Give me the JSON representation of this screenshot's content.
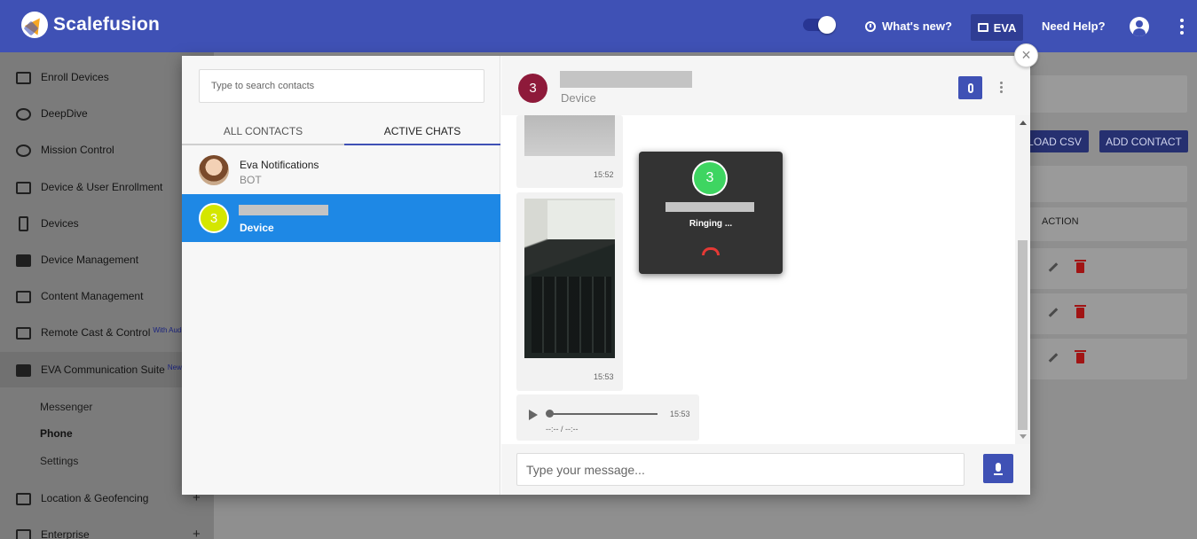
{
  "header": {
    "brand": "Scalefusion",
    "whats_new": "What's new?",
    "eva_label": "EVA",
    "need_help": "Need Help?"
  },
  "sidebar": {
    "items": [
      {
        "label": "Enroll Devices",
        "icon": "enroll-icon"
      },
      {
        "label": "DeepDive",
        "icon": "deepdive-icon"
      },
      {
        "label": "Mission Control",
        "icon": "mission-control-icon"
      },
      {
        "label": "Device & User Enrollment",
        "icon": "device-user-icon"
      },
      {
        "label": "Devices",
        "icon": "phone-icon"
      },
      {
        "label": "Device Management",
        "icon": "briefcase-icon"
      },
      {
        "label": "Content Management",
        "icon": "folder-icon"
      },
      {
        "label": "Remote Cast & Control",
        "icon": "cast-icon",
        "badge": "With Audio"
      },
      {
        "label": "EVA Communication Suite",
        "icon": "chat-icon",
        "badge": "New"
      }
    ],
    "subitems": [
      "Messenger",
      "Phone",
      "Settings"
    ],
    "more_items": [
      {
        "label": "Location & Geofencing",
        "icon": "map-icon"
      },
      {
        "label": "Enterprise",
        "icon": "enterprise-icon"
      }
    ]
  },
  "background": {
    "upload_csv": "LOAD CSV",
    "add_contact": "ADD CONTACT",
    "action_header": "ACTION"
  },
  "contacts_panel": {
    "search_placeholder": "Type to search contacts",
    "tabs": [
      "ALL CONTACTS",
      "ACTIVE CHATS"
    ],
    "active_tab": "ACTIVE CHATS",
    "contacts": [
      {
        "name": "Eva Notifications",
        "subtitle": "BOT"
      },
      {
        "name": "",
        "subtitle": "Device",
        "avatar_text": "3",
        "selected": true
      }
    ]
  },
  "chat": {
    "avatar_text": "3",
    "subtitle": "Device",
    "messages": [
      {
        "type": "image",
        "time": "15:52"
      },
      {
        "type": "image",
        "time": "15:53"
      },
      {
        "type": "audio",
        "time": "15:53",
        "duration": "--:-- / --:--"
      }
    ],
    "call": {
      "avatar_text": "3",
      "status": "Ringing ..."
    },
    "composer_placeholder": "Type your message..."
  },
  "colors": {
    "primary": "#3f51b5",
    "selected_contact": "#1e88e5",
    "call_avatar": "#3ed561",
    "hangup": "#e53935"
  }
}
